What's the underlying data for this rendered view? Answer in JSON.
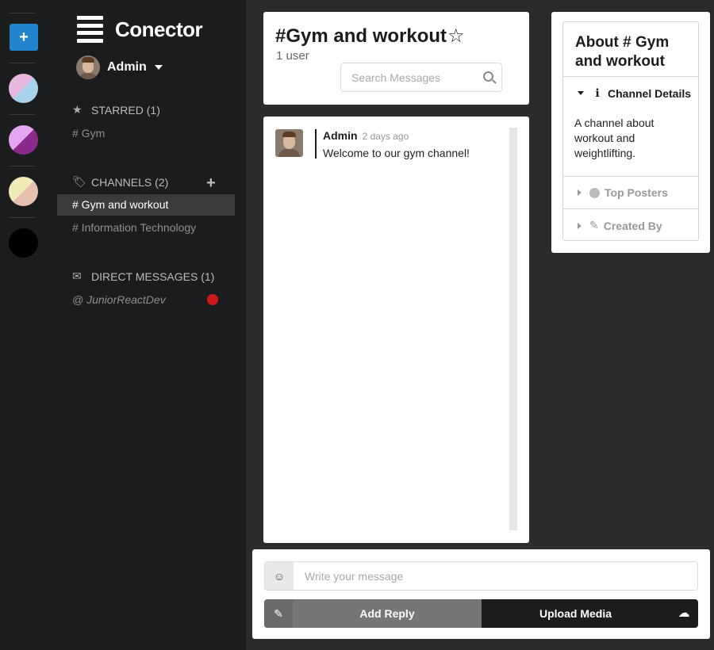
{
  "rail": {
    "add_label": "+",
    "swatches": [
      {
        "colors": [
          "#e8b8e0",
          "#a9d3ea"
        ]
      },
      {
        "colors": [
          "#e4a6ee",
          "#8a2a8a"
        ]
      },
      {
        "colors": [
          "#f0eab8",
          "#e8c0b0"
        ]
      },
      {
        "colors": [
          "#000000",
          "#000000"
        ]
      }
    ]
  },
  "sidebar": {
    "brand": "Conector",
    "user_name": "Admin",
    "starred": {
      "label": "STARRED (1)",
      "items": [
        "# Gym"
      ]
    },
    "channels": {
      "label": "CHANNELS (2)",
      "items": [
        "# Gym and workout",
        "# Information Technology"
      ],
      "active_index": 0,
      "add_label": "+"
    },
    "direct_messages": {
      "label": "DIRECT MESSAGES (1)",
      "items": [
        "@ JuniorReactDev"
      ],
      "status_color": "#d01919"
    }
  },
  "header": {
    "title": "#Gym and workout",
    "star": "☆",
    "user_count": "1 user",
    "search_placeholder": "Search Messages"
  },
  "messages": [
    {
      "author": "Admin",
      "time": "2 days ago",
      "text": "Welcome to our gym channel!"
    }
  ],
  "about": {
    "title": "About # Gym and workout",
    "details_label": "Channel Details",
    "details_body": "A channel about workout and weightlifting.",
    "top_posters_label": "Top Posters",
    "created_by_label": "Created By"
  },
  "composer": {
    "emoji_icon": "☺",
    "placeholder": "Write your message",
    "reply_label": "Add Reply",
    "upload_label": "Upload Media"
  },
  "colors": {
    "accent": "#2185d0",
    "sidebar_bg": "#1b1c1d",
    "page_bg": "#2b2b2e",
    "status_red": "#d01919"
  }
}
